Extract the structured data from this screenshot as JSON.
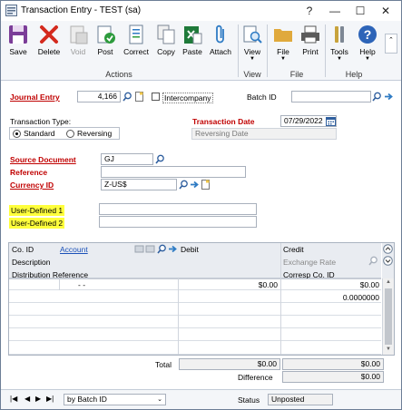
{
  "window": {
    "title": "Transaction Entry  -  TEST (sa)",
    "controls": {
      "help": "?",
      "minimize": "—",
      "maximize": "☐",
      "close": "✕"
    }
  },
  "ribbon": {
    "actions": [
      {
        "label": "Save",
        "icon": "save-icon"
      },
      {
        "label": "Delete",
        "icon": "delete-icon"
      },
      {
        "label": "Void",
        "icon": "void-icon"
      },
      {
        "label": "Post",
        "icon": "post-icon"
      },
      {
        "label": "Correct",
        "icon": "correct-icon"
      },
      {
        "label": "Copy",
        "icon": "copy-icon"
      },
      {
        "label": "Paste",
        "icon": "paste-icon"
      },
      {
        "label": "Attach",
        "icon": "attach-icon"
      }
    ],
    "actions_group": "Actions",
    "view": {
      "label": "View",
      "group": "View"
    },
    "file": {
      "file_label": "File",
      "print_label": "Print",
      "group": "File"
    },
    "help": {
      "tools_label": "Tools",
      "help_label": "Help",
      "group": "Help"
    }
  },
  "form": {
    "journal_entry_label": "Journal Entry",
    "journal_entry_value": "4,166",
    "intercompany_label": "Intercompany",
    "batch_id_label": "Batch ID",
    "batch_id_value": "",
    "transaction_type_label": "Transaction Type:",
    "standard_label": "Standard",
    "reversing_label": "Reversing",
    "transaction_date_label": "Transaction Date",
    "transaction_date_value": "07/29/2022",
    "reversing_date_label": "Reversing Date",
    "source_document_label": "Source Document",
    "source_document_value": "GJ",
    "reference_label": "Reference",
    "reference_value": "",
    "currency_id_label": "Currency ID",
    "currency_id_value": "Z-US$",
    "user_defined_1_label": "User-Defined 1",
    "user_defined_1_value": "",
    "user_defined_2_label": "User-Defined 2",
    "user_defined_2_value": ""
  },
  "grid": {
    "headers": {
      "co_id": "Co. ID",
      "account": "Account",
      "debit": "Debit",
      "credit": "Credit",
      "description": "Description",
      "exchange_rate": "Exchange Rate",
      "distribution_reference": "Distribution Reference",
      "corresp_co_id": "Corresp Co. ID"
    },
    "row1": {
      "account": "-        -",
      "debit": "$0.00",
      "credit": "$0.00"
    },
    "row2": {
      "exchange_rate": "0.0000000"
    },
    "total_label": "Total",
    "total_debit": "$0.00",
    "total_credit": "$0.00",
    "difference_label": "Difference",
    "difference_value": "$0.00"
  },
  "footer": {
    "sort_value": "by Batch ID",
    "status_label": "Status",
    "status_value": "Unposted"
  },
  "colors": {
    "required_label": "#c00000",
    "highlight": "#ffff3c",
    "link": "#1a50b8"
  }
}
